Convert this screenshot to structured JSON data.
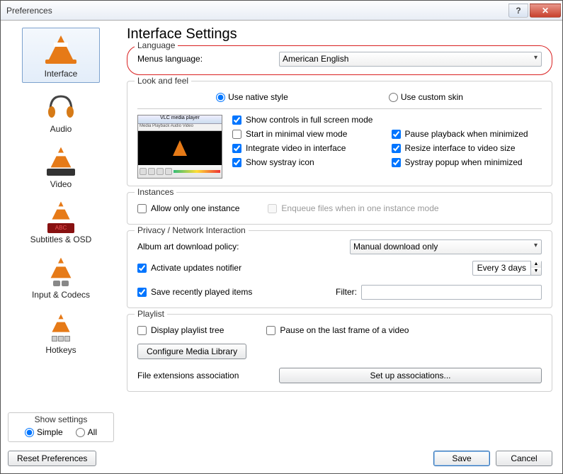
{
  "window": {
    "title": "Preferences"
  },
  "sidebar": {
    "items": [
      {
        "label": "Interface"
      },
      {
        "label": "Audio"
      },
      {
        "label": "Video"
      },
      {
        "label": "Subtitles & OSD"
      },
      {
        "label": "Input & Codecs"
      },
      {
        "label": "Hotkeys"
      }
    ],
    "show_settings_label": "Show settings",
    "simple_label": "Simple",
    "all_label": "All"
  },
  "main": {
    "heading": "Interface Settings",
    "language": {
      "legend": "Language",
      "menus_label": "Menus language:",
      "value": "American English"
    },
    "look": {
      "legend": "Look and feel",
      "native_label": "Use native style",
      "custom_label": "Use custom skin",
      "show_controls": "Show controls in full screen mode",
      "start_minimal": "Start in minimal view mode",
      "pause_minimized": "Pause playback when minimized",
      "integrate_video": "Integrate video in interface",
      "resize_interface": "Resize interface to video size",
      "show_systray": "Show systray icon",
      "systray_popup": "Systray popup when minimized"
    },
    "instances": {
      "legend": "Instances",
      "allow_one": "Allow only one instance",
      "enqueue": "Enqueue files when in one instance mode"
    },
    "privacy": {
      "legend": "Privacy / Network Interaction",
      "album_art_label": "Album art download policy:",
      "album_art_value": "Manual download only",
      "updates_label": "Activate updates notifier",
      "updates_value": "Every 3 days",
      "save_recent": "Save recently played items",
      "filter_label": "Filter:",
      "filter_value": ""
    },
    "playlist": {
      "legend": "Playlist",
      "display_tree": "Display playlist tree",
      "pause_last": "Pause on the last frame of a video",
      "configure_btn": "Configure Media Library",
      "file_ext_label": "File extensions association",
      "setup_btn": "Set up associations..."
    }
  },
  "footer": {
    "reset": "Reset Preferences",
    "save": "Save",
    "cancel": "Cancel"
  }
}
